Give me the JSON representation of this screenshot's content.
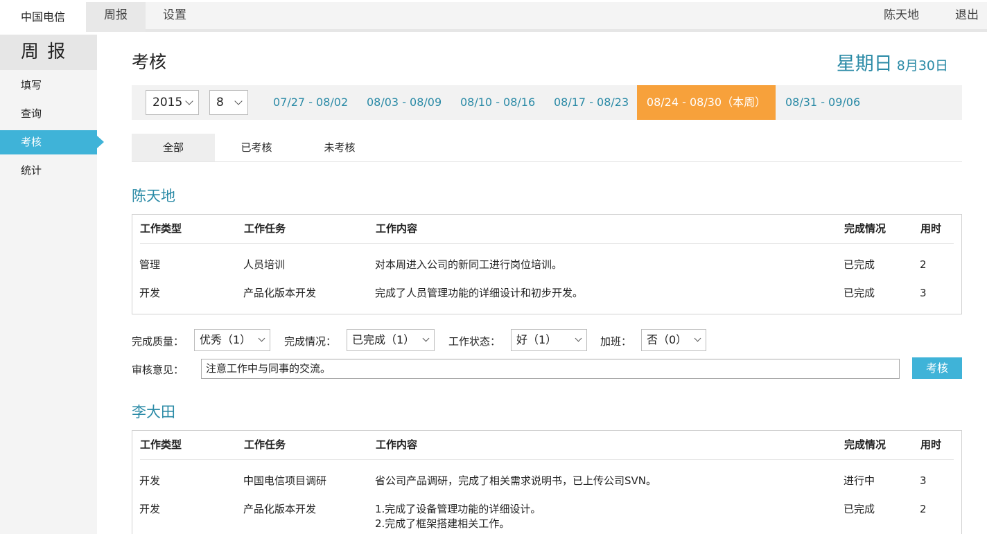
{
  "topbar": {
    "brand": "中国电信",
    "nav_weekly": "周报",
    "nav_settings": "设置",
    "user": "陈天地",
    "logout": "退出"
  },
  "sidebar": {
    "title": "周 报",
    "items": [
      {
        "label": "填写"
      },
      {
        "label": "查询"
      },
      {
        "label": "考核",
        "active": true
      },
      {
        "label": "统计"
      }
    ]
  },
  "page": {
    "title": "考核",
    "weekday": "星期日",
    "date": "8月30日"
  },
  "weekbar": {
    "year": "2015",
    "month": "8",
    "weeks": [
      "07/27 - 08/02",
      "08/03 - 08/09",
      "08/10 - 08/16",
      "08/17 - 08/23",
      "08/24 - 08/30（本周）",
      "08/31 - 09/06"
    ],
    "current_index": 4
  },
  "tabs": [
    "全部",
    "已考核",
    "未考核"
  ],
  "table_headers": {
    "type": "工作类型",
    "task": "工作任务",
    "content": "工作内容",
    "status": "完成情况",
    "hours": "用时"
  },
  "people": [
    {
      "name": "陈天地",
      "rows": [
        {
          "type": "管理",
          "task": "人员培训",
          "content": "对本周进入公司的新同工进行岗位培训。",
          "status": "已完成",
          "hours": "2"
        },
        {
          "type": "开发",
          "task": "产品化版本开发",
          "content": "完成了人员管理功能的详细设计和初步开发。",
          "status": "已完成",
          "hours": "3"
        }
      ],
      "review": {
        "quality_label": "完成质量：",
        "quality_value": "优秀（1）",
        "completion_label": "完成情况：",
        "completion_value": "已完成（1）",
        "state_label": "工作状态：",
        "state_value": "好（1）",
        "overtime_label": "加班：",
        "overtime_value": "否（0）",
        "comment_label": "审核意见：",
        "comment_value": "注意工作中与同事的交流。",
        "button": "考核"
      }
    },
    {
      "name": "李大田",
      "rows": [
        {
          "type": "开发",
          "task": "中国电信项目调研",
          "content": "省公司产品调研，完成了相关需求说明书，已上传公司SVN。",
          "status": "进行中",
          "hours": "3"
        },
        {
          "type": "开发",
          "task": "产品化版本开发",
          "content": "1.完成了设备管理功能的详细设计。",
          "content2": "2.完成了框架搭建相关工作。",
          "status": "已完成",
          "hours": "2"
        }
      ]
    }
  ],
  "colors": {
    "accent": "#3fb3d8",
    "link": "#2a8aa6",
    "current_week": "#f7a13b"
  }
}
